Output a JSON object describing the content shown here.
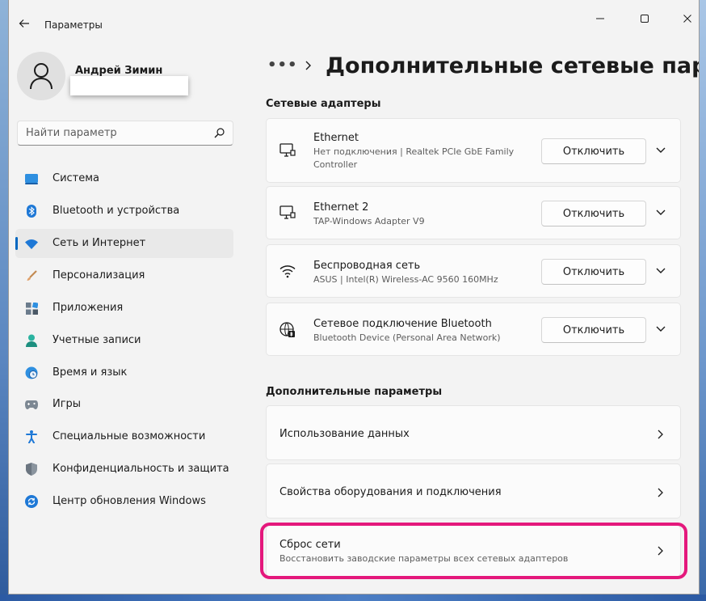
{
  "window": {
    "app_title": "Параметры",
    "back_icon": "back-arrow-icon",
    "controls": [
      "minimize-icon",
      "maximize-icon",
      "close-icon"
    ]
  },
  "profile": {
    "name": "Андрей Зимин"
  },
  "search": {
    "placeholder": "Найти параметр"
  },
  "sidebar": {
    "items": [
      {
        "label": "Система",
        "icon": "system-display-icon",
        "selected": false
      },
      {
        "label": "Bluetooth и устройства",
        "icon": "bluetooth-icon",
        "selected": false
      },
      {
        "label": "Сеть и Интернет",
        "icon": "wifi-network-icon",
        "selected": true
      },
      {
        "label": "Персонализация",
        "icon": "brush-icon",
        "selected": false
      },
      {
        "label": "Приложения",
        "icon": "apps-icon",
        "selected": false
      },
      {
        "label": "Учетные записи",
        "icon": "account-icon",
        "selected": false
      },
      {
        "label": "Время и язык",
        "icon": "globe-clock-icon",
        "selected": false
      },
      {
        "label": "Игры",
        "icon": "gamepad-icon",
        "selected": false
      },
      {
        "label": "Специальные возможности",
        "icon": "accessibility-icon",
        "selected": false
      },
      {
        "label": "Конфиденциальность и защита",
        "icon": "shield-icon",
        "selected": false
      },
      {
        "label": "Центр обновления Windows",
        "icon": "windows-update-icon",
        "selected": false
      }
    ]
  },
  "main": {
    "breadcrumb_dots": "•••",
    "title": "Дополнительные сетевые парамет",
    "adapters_title": "Сетевые адаптеры",
    "adapters": [
      {
        "name": "Ethernet",
        "desc": "Нет подключения | Realtek PCIe GbE Family Controller",
        "icon": "ethernet-icon",
        "action": "Отключить"
      },
      {
        "name": "Ethernet 2",
        "desc": "TAP-Windows Adapter V9",
        "icon": "ethernet-icon",
        "action": "Отключить"
      },
      {
        "name": "Беспроводная сеть",
        "desc": "ASUS | Intel(R) Wireless-AC 9560 160MHz",
        "icon": "wifi-icon",
        "action": "Отключить"
      },
      {
        "name": "Сетевое подключение Bluetooth",
        "desc": "Bluetooth Device (Personal Area Network)",
        "icon": "bluetooth-network-icon",
        "action": "Отключить"
      }
    ],
    "more_title": "Дополнительные параметры",
    "links": [
      {
        "label": "Использование данных",
        "sub": ""
      },
      {
        "label": "Свойства оборудования и подключения",
        "sub": ""
      },
      {
        "label": "Сброс сети",
        "sub": "Восстановить заводские параметры всех сетевых адаптеров"
      }
    ]
  },
  "colors": {
    "accent": "#0067c0",
    "highlight": "#e4187c",
    "background": "#f3f3f3",
    "card": "#fbfbfb"
  }
}
